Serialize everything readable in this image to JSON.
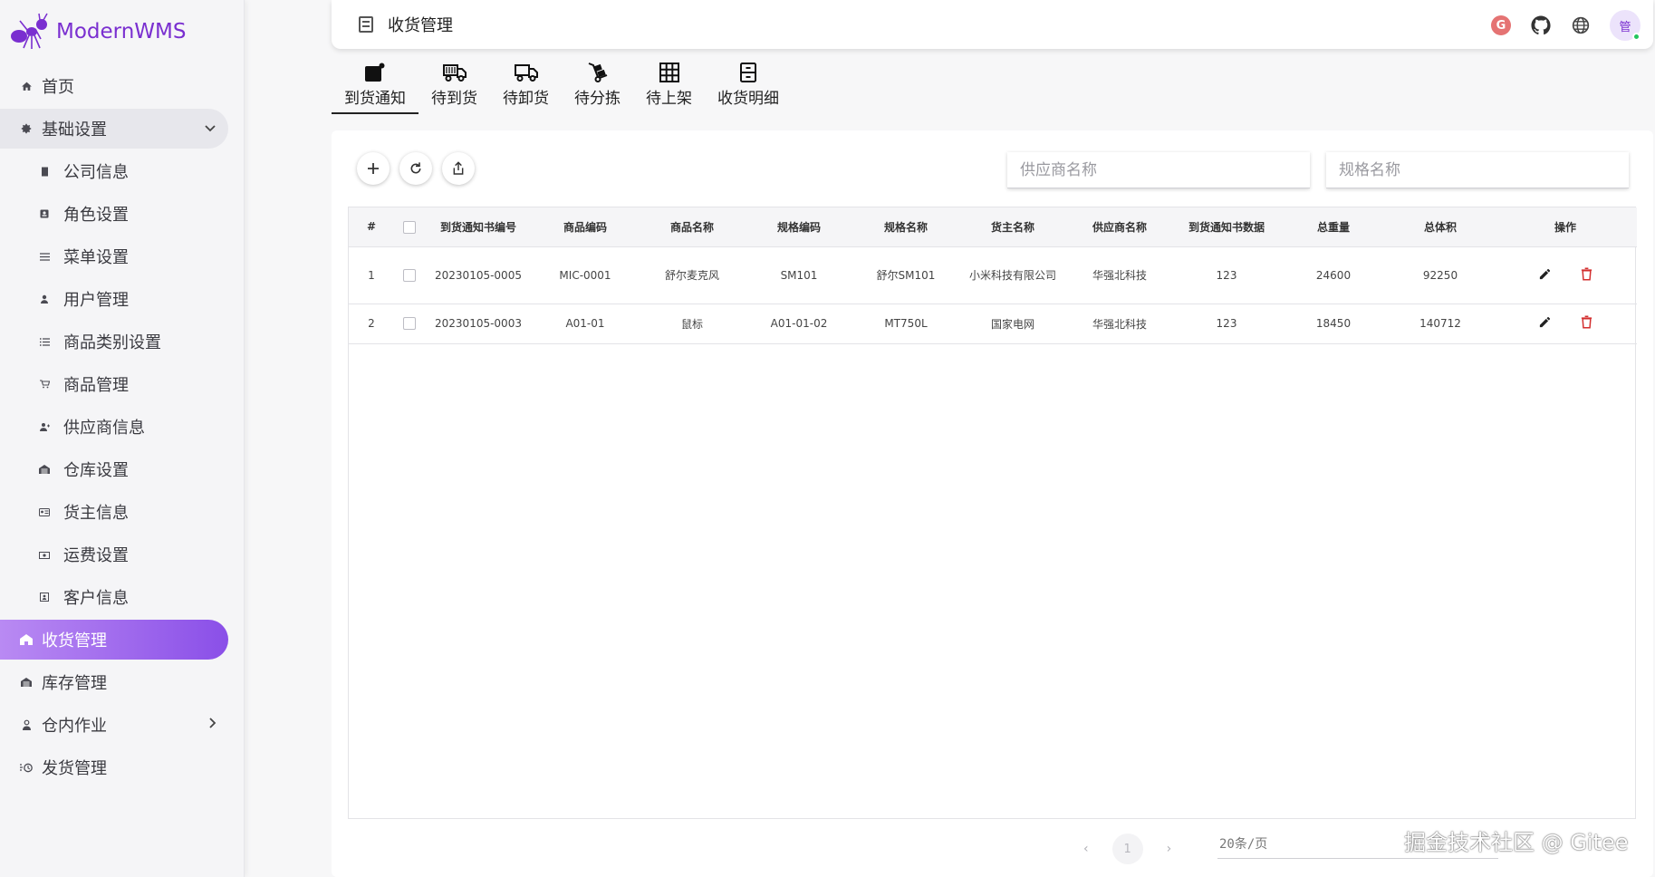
{
  "brand": {
    "title": "ModernWMS"
  },
  "sidebar": {
    "items": [
      {
        "label": "首页",
        "icon": "home-icon",
        "level": "top"
      },
      {
        "label": "基础设置",
        "icon": "gear-icon",
        "level": "group-open"
      },
      {
        "label": "公司信息",
        "icon": "document-icon",
        "level": "sub"
      },
      {
        "label": "角色设置",
        "icon": "id-badge-icon",
        "level": "sub"
      },
      {
        "label": "菜单设置",
        "icon": "menu-icon",
        "level": "sub"
      },
      {
        "label": "用户管理",
        "icon": "person-icon",
        "level": "sub"
      },
      {
        "label": "商品类别设置",
        "icon": "list-icon",
        "level": "sub"
      },
      {
        "label": "商品管理",
        "icon": "cart-icon",
        "level": "sub"
      },
      {
        "label": "供应商信息",
        "icon": "supplier-icon",
        "level": "sub"
      },
      {
        "label": "仓库设置",
        "icon": "warehouse-icon",
        "level": "sub"
      },
      {
        "label": "货主信息",
        "icon": "owner-card-icon",
        "level": "sub"
      },
      {
        "label": "运费设置",
        "icon": "cash-icon",
        "level": "sub"
      },
      {
        "label": "客户信息",
        "icon": "contact-icon",
        "level": "sub"
      },
      {
        "label": "收货管理",
        "icon": "receiving-icon",
        "level": "active"
      },
      {
        "label": "库存管理",
        "icon": "warehouse-icon",
        "level": "top"
      },
      {
        "label": "仓内作业",
        "icon": "worker-icon",
        "level": "group-closed"
      },
      {
        "label": "发货管理",
        "icon": "shipping-icon",
        "level": "top"
      }
    ]
  },
  "header": {
    "title": "收货管理"
  },
  "header_icons": [
    "gitee-icon",
    "github-icon",
    "globe-icon"
  ],
  "avatar": {
    "text": "管"
  },
  "tabs": [
    {
      "label": "到货通知",
      "icon": "arrival-notice-icon",
      "active": true
    },
    {
      "label": "待到货",
      "icon": "truck-icon",
      "active": false
    },
    {
      "label": "待卸货",
      "icon": "unload-truck-icon",
      "active": false
    },
    {
      "label": "待分拣",
      "icon": "hand-truck-icon",
      "active": false
    },
    {
      "label": "待上架",
      "icon": "grid-icon",
      "active": false
    },
    {
      "label": "收货明细",
      "icon": "file-cabinet-icon",
      "active": false
    }
  ],
  "toolbar": {
    "add_icon": "plus-icon",
    "refresh_icon": "refresh-icon",
    "export_icon": "export-icon"
  },
  "filters": {
    "supplier_placeholder": "供应商名称",
    "spec_placeholder": "规格名称"
  },
  "table": {
    "columns": [
      "#",
      "",
      "到货通知书编号",
      "商品编码",
      "商品名称",
      "规格编码",
      "规格名称",
      "货主名称",
      "供应商名称",
      "到货通知书数据",
      "总重量",
      "总体积",
      "操作"
    ],
    "rows": [
      {
        "index": "1",
        "asn_no": "20230105-0005",
        "spu_code": "MIC-0001",
        "spu_name": "舒尔麦克风",
        "sku_code": "SM101",
        "sku_name": "舒尔SM101",
        "owner": "小米科技有限公司",
        "supplier": "华强北科技",
        "asn_qty": "123",
        "weight": "24600",
        "volume": "92250"
      },
      {
        "index": "2",
        "asn_no": "20230105-0003",
        "spu_code": "A01-01",
        "spu_name": "鼠标",
        "sku_code": "A01-01-02",
        "sku_name": "MT750L",
        "owner": "国家电网",
        "supplier": "华强北科技",
        "asn_qty": "123",
        "weight": "18450",
        "volume": "140712"
      }
    ]
  },
  "pagination": {
    "current": "1",
    "per_page": "20条/页"
  },
  "watermark": "掘金技术社区 @ Gitee",
  "colors": {
    "accent": "#8a4fe8",
    "brand": "#7a2fd0",
    "delete": "#d32f2f"
  }
}
